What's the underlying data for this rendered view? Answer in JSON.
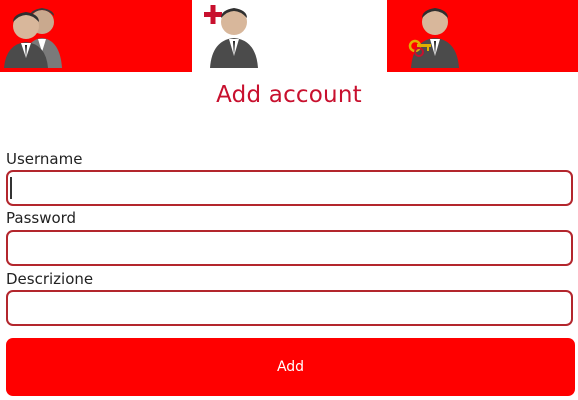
{
  "tabs": [
    {
      "icon": "users-group-icon",
      "selected": false
    },
    {
      "icon": "add-user-icon",
      "selected": true
    },
    {
      "icon": "admin-key-icon",
      "selected": false
    }
  ],
  "title": "Add account",
  "form": {
    "username_label": "Username",
    "username_value": "",
    "password_label": "Password",
    "password_value": "",
    "description_label": "Descrizione",
    "description_value": ""
  },
  "add_button_label": "Add",
  "colors": {
    "accent": "#ff0000",
    "title": "#c8102e",
    "input_border": "#b3262d",
    "background": "#ffffff"
  }
}
